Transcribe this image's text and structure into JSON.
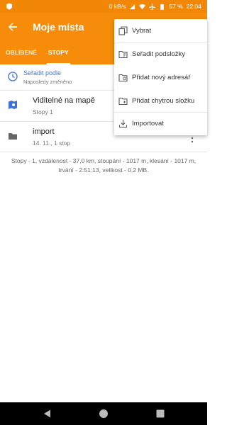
{
  "status_bar": {
    "network_speed": "0 kB/s",
    "battery": "57 %",
    "time": "22:04"
  },
  "app_bar": {
    "title": "Moje místa",
    "tabs": [
      {
        "label": "OBLÍBENÉ",
        "active": false
      },
      {
        "label": "STOPY",
        "active": true
      }
    ]
  },
  "sort": {
    "label": "Seřadit podle",
    "value": "Naposledy změněno"
  },
  "items": [
    {
      "title": "Viditelné na mapě",
      "subtitle": "Stopy 1",
      "icon": "map-visible-icon"
    },
    {
      "title": "import",
      "subtitle": "14. 11., 1 stop",
      "icon": "folder-icon"
    }
  ],
  "stats": "Stopy - 1, vzdálenost - 37,0 km, stoupání - 1017 m, klesání - 1017 m, trvání - 2:51:13, velikost - 0.2 MB.",
  "menu": {
    "items": [
      {
        "label": "Vybrat",
        "icon": "select-icon"
      },
      {
        "label": "Seřadit podsložky",
        "icon": "sort-folders-icon"
      },
      {
        "label": "Přidat nový adresář",
        "icon": "new-folder-icon"
      },
      {
        "label": "Přidat chytrou složku",
        "icon": "smart-folder-icon"
      },
      {
        "label": "Importovat",
        "icon": "import-icon"
      }
    ]
  },
  "colors": {
    "accent": "#f68c0a",
    "link": "#3b72d8"
  }
}
